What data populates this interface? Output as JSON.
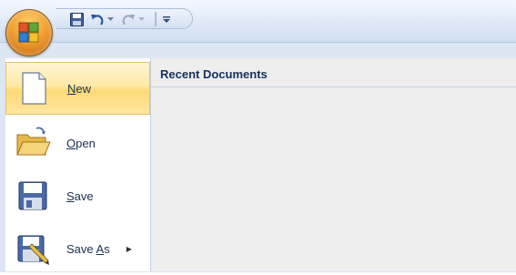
{
  "quick_access": {
    "save_icon": "save-icon",
    "undo_icon": "undo-icon",
    "redo_icon": "redo-icon",
    "customize_icon": "customize-icon"
  },
  "menu": {
    "items": [
      {
        "mnemonic": "N",
        "rest": "ew",
        "icon": "new-document-icon"
      },
      {
        "mnemonic": "O",
        "rest": "pen",
        "icon": "open-folder-icon"
      },
      {
        "mnemonic": "S",
        "rest": "ave",
        "icon": "save-disk-icon"
      },
      {
        "pre": "Save ",
        "mnemonic": "A",
        "rest": "s",
        "icon": "save-as-icon"
      }
    ]
  },
  "recent": {
    "title": "Recent Documents"
  },
  "colors": {
    "selected_highlight": "#ffd977",
    "pane_background": "#eeeeee"
  }
}
